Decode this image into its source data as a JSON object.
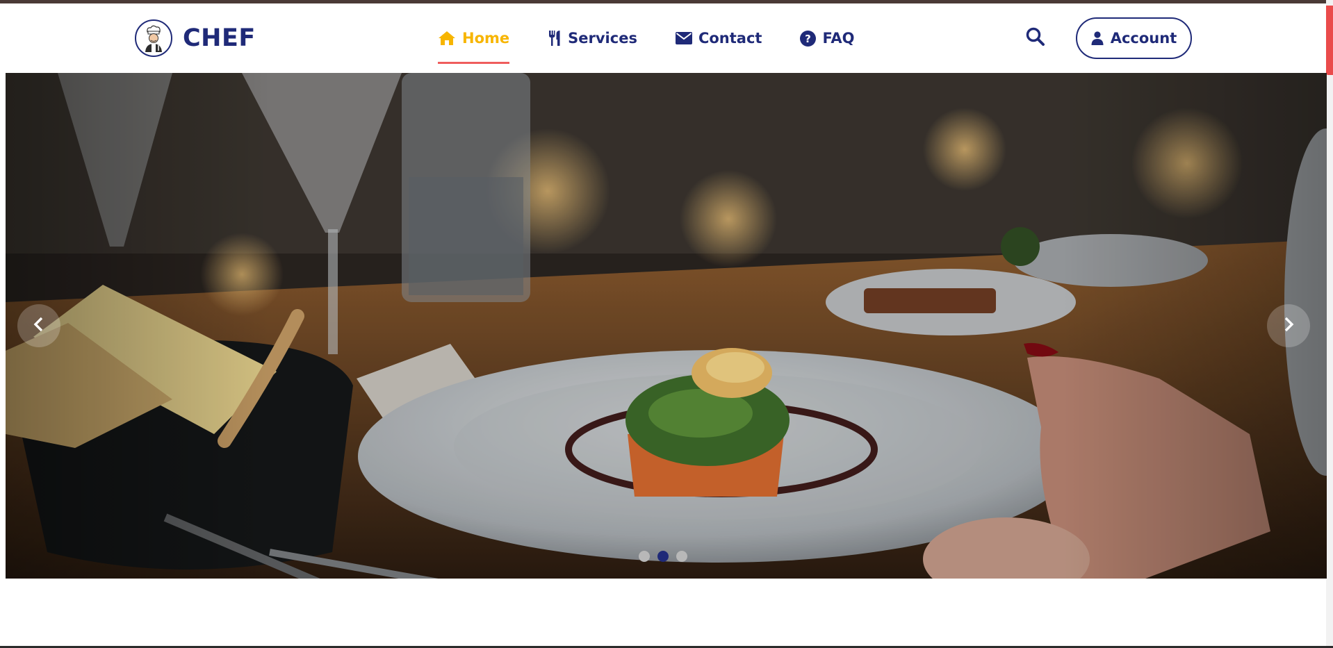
{
  "brand": {
    "name": "CHEF"
  },
  "nav": {
    "items": [
      {
        "label": "Home",
        "icon": "home-icon",
        "active": true
      },
      {
        "label": "Services",
        "icon": "utensils-icon",
        "active": false
      },
      {
        "label": "Contact",
        "icon": "envelope-icon",
        "active": false
      },
      {
        "label": "FAQ",
        "icon": "question-circle-icon",
        "active": false
      }
    ]
  },
  "account": {
    "label": "Account",
    "icon": "user-icon"
  },
  "search": {
    "icon": "search-icon"
  },
  "carousel": {
    "slide_count": 3,
    "active_slide": 2,
    "prev_icon": "chevron-left-icon",
    "next_icon": "chevron-right-icon",
    "image": "plated fish dish on restaurant table"
  },
  "colors": {
    "brand": "#1f2a78",
    "active_nav": "#f7b500",
    "active_underline": "#ef5d5d",
    "top_strip": "#4a3a36"
  }
}
